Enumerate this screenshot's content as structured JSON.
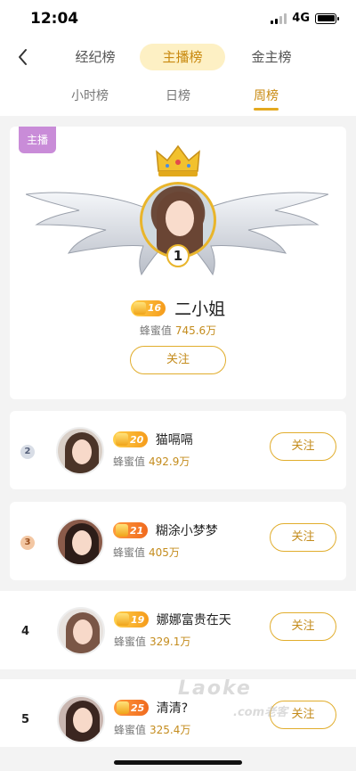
{
  "status": {
    "time": "12:04",
    "network": "4G"
  },
  "nav": {
    "tabs": [
      {
        "label": "经纪榜"
      },
      {
        "label": "主播榜"
      },
      {
        "label": "金主榜"
      }
    ],
    "active_tab": "主播榜",
    "subtabs": [
      {
        "label": "小时榜"
      },
      {
        "label": "日榜"
      },
      {
        "label": "周榜"
      }
    ],
    "active_subtab": "周榜"
  },
  "top": {
    "badge": "主播",
    "rank": "1",
    "level": "16",
    "name": "二小姐",
    "score_label": "蜂蜜值",
    "score": "745.6万",
    "follow_label": "关注"
  },
  "rows": [
    {
      "rank": "2",
      "level": "20",
      "name": "猫嗝嗝",
      "score_label": "蜂蜜值",
      "score": "492.9万",
      "follow_label": "关注"
    },
    {
      "rank": "3",
      "level": "21",
      "name": "糊涂小梦梦",
      "score_label": "蜂蜜值",
      "score": "405万",
      "follow_label": "关注"
    },
    {
      "rank": "4",
      "level": "19",
      "name": "娜娜富贵在天",
      "score_label": "蜂蜜值",
      "score": "329.1万",
      "follow_label": "关注"
    },
    {
      "rank": "5",
      "level": "25",
      "name": "清清?",
      "score_label": "蜂蜜值",
      "score": "325.4万",
      "follow_label": "关注"
    }
  ],
  "watermark": {
    "main": "Laoke",
    "sub": ".com老客"
  },
  "colors": {
    "accent": "#e1ad2c",
    "accent_text": "#c48c1d",
    "host_badge": "#c98cd8"
  }
}
